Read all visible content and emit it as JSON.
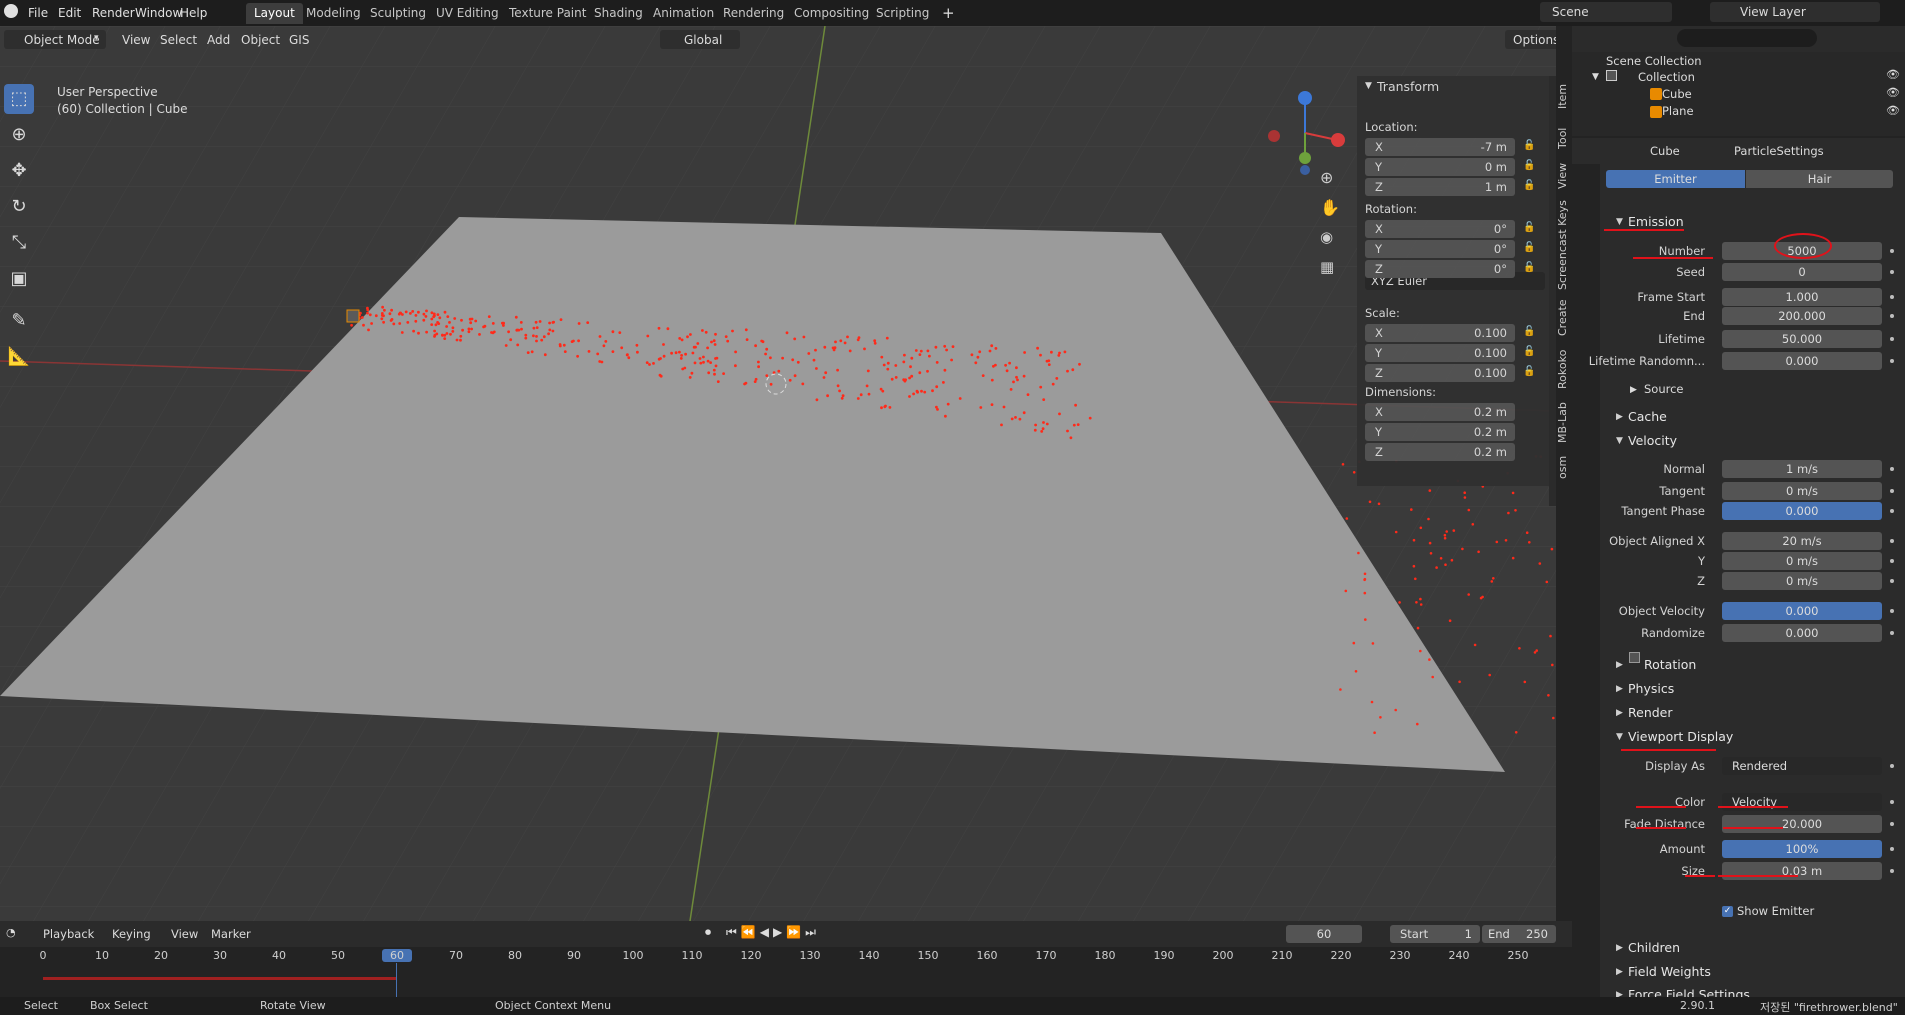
{
  "topmenu": [
    "File",
    "Edit",
    "Render",
    "Window",
    "Help"
  ],
  "workspaces": [
    "Layout",
    "Modeling",
    "Sculpting",
    "UV Editing",
    "Texture Paint",
    "Shading",
    "Animation",
    "Rendering",
    "Compositing",
    "Scripting"
  ],
  "scene_name": "Scene",
  "view_layer": "View Layer",
  "header": {
    "mode": "Object Mode",
    "menus": [
      "View",
      "Select",
      "Add",
      "Object",
      "GIS"
    ],
    "orientation": "Global",
    "options": "Options"
  },
  "viewport": {
    "title": "User Perspective",
    "subtitle": "(60) Collection | Cube"
  },
  "transform": {
    "title": "Transform",
    "location_label": "Location:",
    "location": [
      "-7 m",
      "0 m",
      "1 m"
    ],
    "rotation_label": "Rotation:",
    "rotation": [
      "0°",
      "0°",
      "0°"
    ],
    "euler": "XYZ Euler",
    "scale_label": "Scale:",
    "scale": [
      "0.100",
      "0.100",
      "0.100"
    ],
    "dimensions_label": "Dimensions:",
    "dimensions": [
      "0.2 m",
      "0.2 m",
      "0.2 m"
    ],
    "axes": [
      "X",
      "Y",
      "Z"
    ]
  },
  "sidetabs": [
    "Item",
    "Tool",
    "View",
    "Screencast Keys",
    "Create",
    "Rokoko",
    "MB-Lab",
    "osm"
  ],
  "outliner": {
    "root": "Scene Collection",
    "collection": "Collection",
    "items": [
      "Cube",
      "Plane"
    ]
  },
  "props": {
    "object": "Cube",
    "particle_settings": "ParticleSettings",
    "emitter": "Emitter",
    "hair": "Hair",
    "emission": "Emission",
    "number_label": "Number",
    "number": "5000",
    "seed_label": "Seed",
    "seed": "0",
    "frame_start_label": "Frame Start",
    "frame_start": "1.000",
    "end_label": "End",
    "end": "200.000",
    "lifetime_label": "Lifetime",
    "lifetime": "50.000",
    "lifetime_random_label": "Lifetime Randomn...",
    "lifetime_random": "0.000",
    "source": "Source",
    "cache": "Cache",
    "velocity": "Velocity",
    "normal_label": "Normal",
    "normal": "1 m/s",
    "tangent_label": "Tangent",
    "tangent": "0 m/s",
    "tangent_phase_label": "Tangent Phase",
    "tangent_phase": "0.000",
    "oax_label": "Object Aligned X",
    "oax": "20 m/s",
    "y_label": "Y",
    "oay": "0 m/s",
    "z_label": "Z",
    "oaz": "0 m/s",
    "objvel_label": "Object Velocity",
    "objvel": "0.000",
    "randomize_label": "Randomize",
    "randomize": "0.000",
    "rotation": "Rotation",
    "physics": "Physics",
    "render": "Render",
    "viewport_display": "Viewport Display",
    "display_as_label": "Display As",
    "display_as": "Rendered",
    "color_label": "Color",
    "color": "Velocity",
    "fade_label": "Fade Distance",
    "fade": "20.000",
    "amount_label": "Amount",
    "amount": "100%",
    "size_label": "Size",
    "size": "0.03 m",
    "show_emitter": "Show Emitter",
    "children": "Children",
    "field_weights": "Field Weights",
    "force_field": "Force Field Settings"
  },
  "timeline": {
    "menus": [
      "Playback",
      "Keying",
      "View",
      "Marker"
    ],
    "current": "60",
    "start_label": "Start",
    "start": "1",
    "end_label": "End",
    "end": "250",
    "ticks": [
      "0",
      "10",
      "20",
      "30",
      "40",
      "50",
      "60",
      "70",
      "80",
      "90",
      "100",
      "110",
      "120",
      "130",
      "140",
      "150",
      "160",
      "170",
      "180",
      "190",
      "200",
      "210",
      "220",
      "230",
      "240",
      "250"
    ]
  },
  "status": {
    "select": "Select",
    "box_select": "Box Select",
    "rotate": "Rotate View",
    "context": "Object Context Menu",
    "version": "2.90.1",
    "saved": "저장된 \"firethrower.blend\""
  },
  "colors": {
    "accent": "#4772b3",
    "annotation": "#e0121a",
    "particles": "#ff2a1a"
  }
}
